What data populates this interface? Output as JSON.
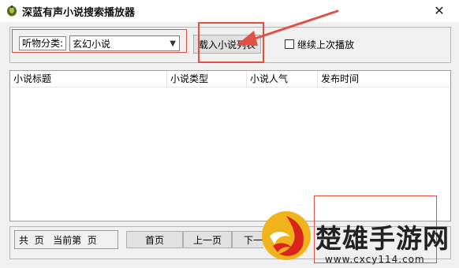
{
  "window": {
    "title": "深蓝有声小说搜索播放器",
    "close_glyph": "✕"
  },
  "toolbar": {
    "category_label": "听物分类:",
    "category_value": "玄幻小说",
    "load_button": "载入小说列表",
    "resume_label": "继续上次播放",
    "resume_checked": false
  },
  "table": {
    "columns": [
      "小说标题",
      "小说类型",
      "小说人气",
      "发布时间"
    ],
    "rows": []
  },
  "pagination": {
    "info": "共  页   当前第  页",
    "first_button": "首页",
    "prev_button": "上一页",
    "next_button": "下一"
  },
  "watermark": {
    "brand": "楚雄手游网",
    "url": "www.cxcy114.com"
  },
  "annotation_color": "#e15045"
}
